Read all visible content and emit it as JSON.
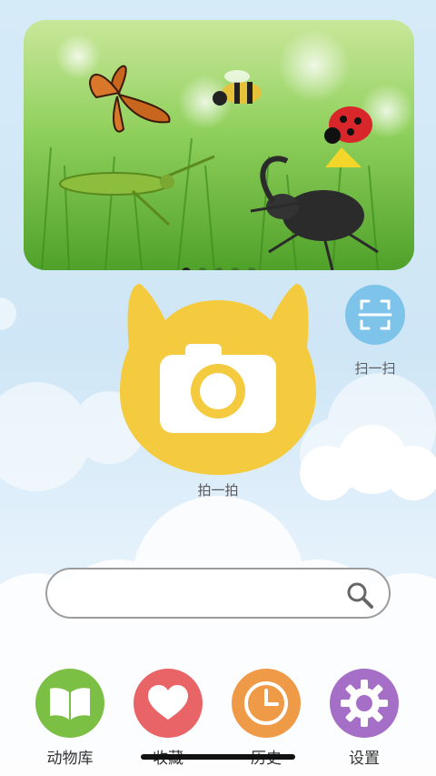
{
  "banner": {
    "slide_count": 5,
    "active_index": 0,
    "alt": "insects banner"
  },
  "capture": {
    "label": "拍一拍",
    "icon": "camera-icon",
    "color": "#f4cb3f"
  },
  "scan": {
    "label": "扫一扫",
    "icon": "scan-icon",
    "color": "#7ec3ea"
  },
  "search": {
    "value": "",
    "placeholder": "",
    "icon": "search-icon"
  },
  "nav": {
    "items": [
      {
        "label": "动物库",
        "icon": "book-icon",
        "color": "#7cbf45"
      },
      {
        "label": "收藏",
        "icon": "heart-icon",
        "color": "#e96466"
      },
      {
        "label": "历史",
        "icon": "clock-icon",
        "color": "#ee9a47"
      },
      {
        "label": "设置",
        "icon": "gear-icon",
        "color": "#a56fc8"
      }
    ]
  }
}
